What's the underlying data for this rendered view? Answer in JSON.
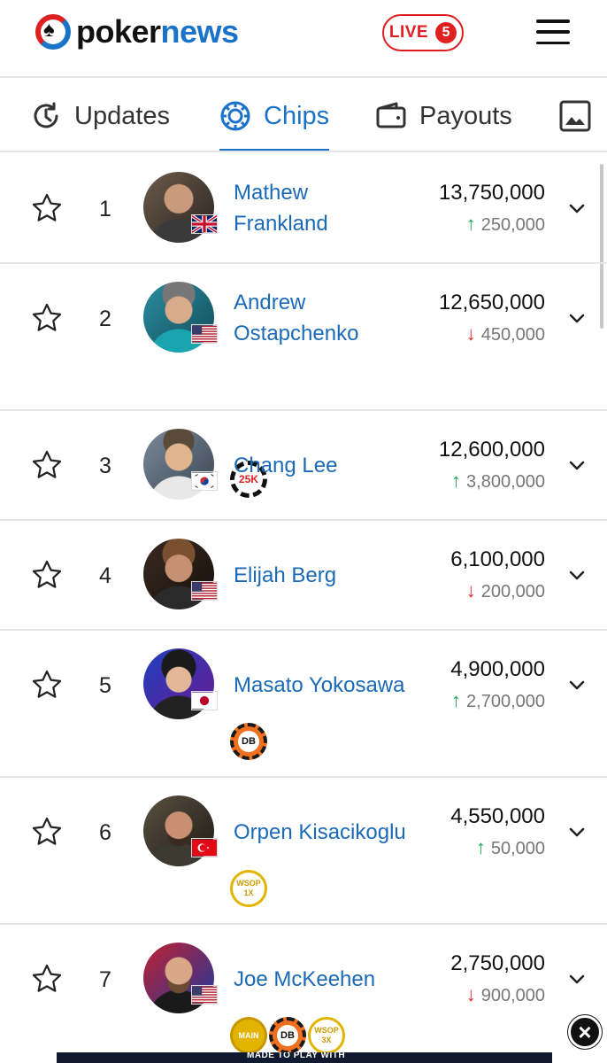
{
  "header": {
    "logo_part1": "poker",
    "logo_part2": "news",
    "live_label": "LIVE",
    "live_count": "5"
  },
  "tabs": [
    {
      "label": "Updates",
      "icon": "clock-icon"
    },
    {
      "label": "Chips",
      "icon": "chip-icon",
      "active": true
    },
    {
      "label": "Payouts",
      "icon": "wallet-icon"
    },
    {
      "label": "",
      "icon": "image-icon"
    }
  ],
  "players": [
    {
      "rank": "1",
      "name_line1": "Mathew",
      "name_line2": "Frankland",
      "chips": "13,750,000",
      "delta": "250,000",
      "direction": "up",
      "flag": "UK"
    },
    {
      "rank": "2",
      "name_line1": "Andrew",
      "name_line2": "Ostapchenko",
      "chips": "12,650,000",
      "delta": "450,000",
      "direction": "down",
      "flag": "US",
      "badges": [
        {
          "type": "b25k",
          "text": "25K"
        }
      ]
    },
    {
      "rank": "3",
      "name_line1": "Chang Lee",
      "chips": "12,600,000",
      "delta": "3,800,000",
      "direction": "up",
      "flag": "KR"
    },
    {
      "rank": "4",
      "name_line1": "Elijah Berg",
      "chips": "6,100,000",
      "delta": "200,000",
      "direction": "down",
      "flag": "US"
    },
    {
      "rank": "5",
      "name_line1": "Masato Yokosawa",
      "chips": "4,900,000",
      "delta": "2,700,000",
      "direction": "up",
      "flag": "JP",
      "badges": [
        {
          "type": "bdb",
          "text": "DB"
        }
      ]
    },
    {
      "rank": "6",
      "name_line1": "Orpen Kisacikoglu",
      "chips": "4,550,000",
      "delta": "50,000",
      "direction": "up",
      "flag": "TR",
      "badges": [
        {
          "type": "bwsop",
          "text": "WSOP 1X"
        }
      ]
    },
    {
      "rank": "7",
      "name_line1": "Joe McKeehen",
      "chips": "2,750,000",
      "delta": "900,000",
      "direction": "down",
      "flag": "US",
      "badges": [
        {
          "type": "bmain",
          "text": "MAIN"
        },
        {
          "type": "bdb",
          "text": "DB"
        },
        {
          "type": "bwsop",
          "text": "WSOP 3X"
        }
      ]
    }
  ],
  "ad": {
    "strip_text": "MADE TO PLAY WITH"
  },
  "colors": {
    "brand_blue": "#1a73c9",
    "live_red": "#e02020",
    "up_green": "#1aa84a",
    "down_red": "#e02020"
  }
}
